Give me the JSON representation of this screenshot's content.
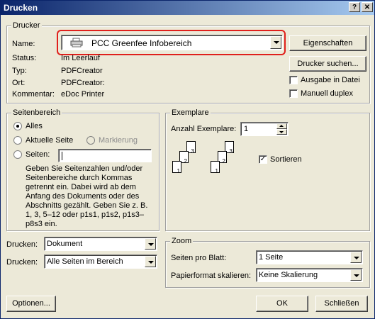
{
  "window": {
    "title": "Drucken",
    "help_btn": "?",
    "close_btn": "✕"
  },
  "printer": {
    "group_label": "Drucker",
    "name_label": "Name:",
    "name_value": "PCC Greenfee Infobereich",
    "properties_btn": "Eigenschaften",
    "find_btn": "Drucker suchen...",
    "status_label": "Status:",
    "status_value": "Im Leerlauf",
    "type_label": "Typ:",
    "type_value": "PDFCreator",
    "where_label": "Ort:",
    "where_value": "PDFCreator:",
    "comment_label": "Kommentar:",
    "comment_value": "eDoc Printer",
    "print_to_file": "Ausgabe in Datei",
    "manual_duplex": "Manuell duplex"
  },
  "range": {
    "group_label": "Seitenbereich",
    "all": "Alles",
    "current": "Aktuelle Seite",
    "selection": "Markierung",
    "pages": "Seiten:",
    "help": "Geben Sie Seitenzahlen und/oder Seitenbereiche durch Kommas getrennt ein. Dabei wird ab dem Anfang des Dokuments oder des Abschnitts gezählt. Geben Sie z. B. 1, 3, 5–12 oder p1s1, p1s2, p1s3–p8s3 ein."
  },
  "copies": {
    "group_label": "Exemplare",
    "count_label": "Anzahl Exemplare:",
    "count_value": "1",
    "collate": "Sortieren",
    "collate_checked": true
  },
  "print_what": {
    "label": "Drucken:",
    "value": "Dokument"
  },
  "print_pages": {
    "label": "Drucken:",
    "value": "Alle Seiten im Bereich"
  },
  "zoom": {
    "group_label": "Zoom",
    "pages_per_sheet_label": "Seiten pro Blatt:",
    "pages_per_sheet_value": "1 Seite",
    "scale_label": "Papierformat skalieren:",
    "scale_value": "Keine Skalierung"
  },
  "buttons": {
    "options": "Optionen...",
    "ok": "OK",
    "close": "Schließen"
  },
  "colors": {
    "highlight": "#e0201c",
    "titlebar": "#0a246a"
  }
}
